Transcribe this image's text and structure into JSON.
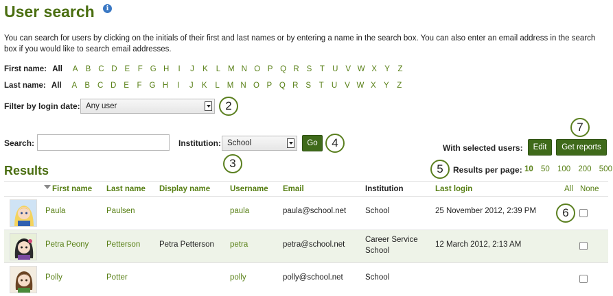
{
  "page": {
    "title": "User search",
    "intro": "You can search for users by clicking on the initials of their first and last names or by entering a name in the search box. You can also enter an email address in the search box if you would like to search email addresses."
  },
  "first_name_filter": {
    "label": "First name:",
    "all": "All"
  },
  "last_name_filter": {
    "label": "Last name:",
    "all": "All"
  },
  "letters": [
    "A",
    "B",
    "C",
    "D",
    "E",
    "F",
    "G",
    "H",
    "I",
    "J",
    "K",
    "L",
    "M",
    "N",
    "O",
    "P",
    "Q",
    "R",
    "S",
    "T",
    "U",
    "V",
    "W",
    "X",
    "Y",
    "Z"
  ],
  "login_filter": {
    "label": "Filter by login date:",
    "value": "Any user"
  },
  "search": {
    "label": "Search:",
    "value": "",
    "institution_label": "Institution:",
    "institution_value": "School",
    "go": "Go"
  },
  "selected": {
    "label": "With selected users:",
    "edit": "Edit",
    "reports": "Get reports"
  },
  "results": {
    "title": "Results",
    "per_page_label": "Results per page:",
    "per_page_options": [
      "10",
      "50",
      "100",
      "200",
      "500"
    ],
    "per_page_selected": "10"
  },
  "callouts": [
    "2",
    "3",
    "4",
    "5",
    "6",
    "7"
  ],
  "table": {
    "headers": {
      "first": "First name",
      "last": "Last name",
      "display": "Display name",
      "username": "Username",
      "email": "Email",
      "institution": "Institution",
      "login": "Last login",
      "all": "All",
      "none": "None"
    },
    "rows": [
      {
        "first": "Paula",
        "last": "Paulsen",
        "display": "",
        "username": "paula",
        "email": "paula@school.net",
        "institution1": "School",
        "institution2": "",
        "login": "25 November 2012, 2:39 PM"
      },
      {
        "first": "Petra Peony",
        "last": "Petterson",
        "display": "Petra Petterson",
        "username": "petra",
        "email": "petra@school.net",
        "institution1": "Career Service",
        "institution2": "School",
        "login": "12 March 2012, 2:13 AM"
      },
      {
        "first": "Polly",
        "last": "Potter",
        "display": "",
        "username": "polly",
        "email": "polly@school.net",
        "institution1": "School",
        "institution2": "",
        "login": ""
      }
    ]
  },
  "colors": {
    "accent": "#4a6e10",
    "link": "#577f14",
    "button": "#3f6a1a",
    "row_alt": "#eef3e8"
  }
}
